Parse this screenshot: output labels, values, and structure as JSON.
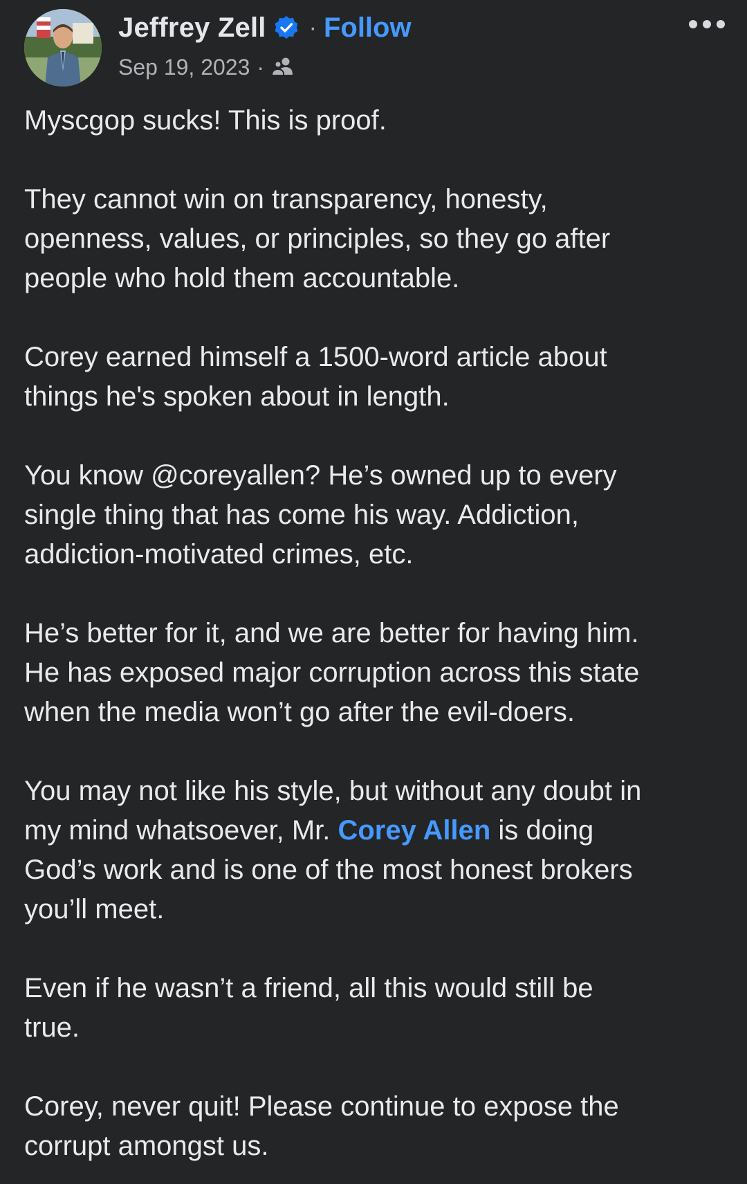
{
  "post": {
    "author": {
      "name": "Jeffrey Zell",
      "verified": true,
      "follow_label": "Follow",
      "separator": "·"
    },
    "meta": {
      "date": "Sep 19, 2023",
      "separator": "·",
      "audience_icon": "friends-icon"
    },
    "more_icon": "more-options-icon",
    "paragraphs": [
      {
        "lines": [
          {
            "text": "Myscgop sucks! This is proof."
          }
        ]
      },
      {
        "lines": [
          {
            "text": "They cannot win on transparency, honesty,"
          },
          {
            "text": "openness, values, or principles, so they go after"
          },
          {
            "text": "people who hold them accountable."
          }
        ]
      },
      {
        "lines": [
          {
            "text": "Corey earned himself a 1500-word article about"
          },
          {
            "text": "things he's spoken about in length."
          }
        ]
      },
      {
        "lines": [
          {
            "text": "You know @coreyallen? He’s owned up to every"
          },
          {
            "text": "single thing that has come his way. Addiction,"
          },
          {
            "text": "addiction-motivated crimes, etc."
          }
        ]
      },
      {
        "lines": [
          {
            "text": "He’s better for it, and we are better for having him."
          },
          {
            "text": "He has exposed major corruption across this state"
          },
          {
            "text": "when the media won’t go after the evil-doers."
          }
        ]
      },
      {
        "lines": [
          {
            "text": "You may not like his style, but without any doubt in"
          },
          {
            "before": "my mind whatsoever, Mr. ",
            "mention": "Corey Allen",
            "after": " is doing"
          },
          {
            "text": "God’s work and is one of the most honest brokers"
          },
          {
            "text": "you’ll meet."
          }
        ]
      },
      {
        "lines": [
          {
            "text": "Even if he wasn’t a friend, all this would still be"
          },
          {
            "text": "true."
          }
        ]
      },
      {
        "lines": [
          {
            "text": "Corey, never quit! Please continue to expose the"
          },
          {
            "text": "corrupt amongst us."
          }
        ]
      }
    ]
  },
  "colors": {
    "background": "#242526",
    "text": "#e8eaed",
    "secondary_text": "#b0b3b8",
    "link": "#4599ff",
    "verified_badge": "#1877f2"
  }
}
